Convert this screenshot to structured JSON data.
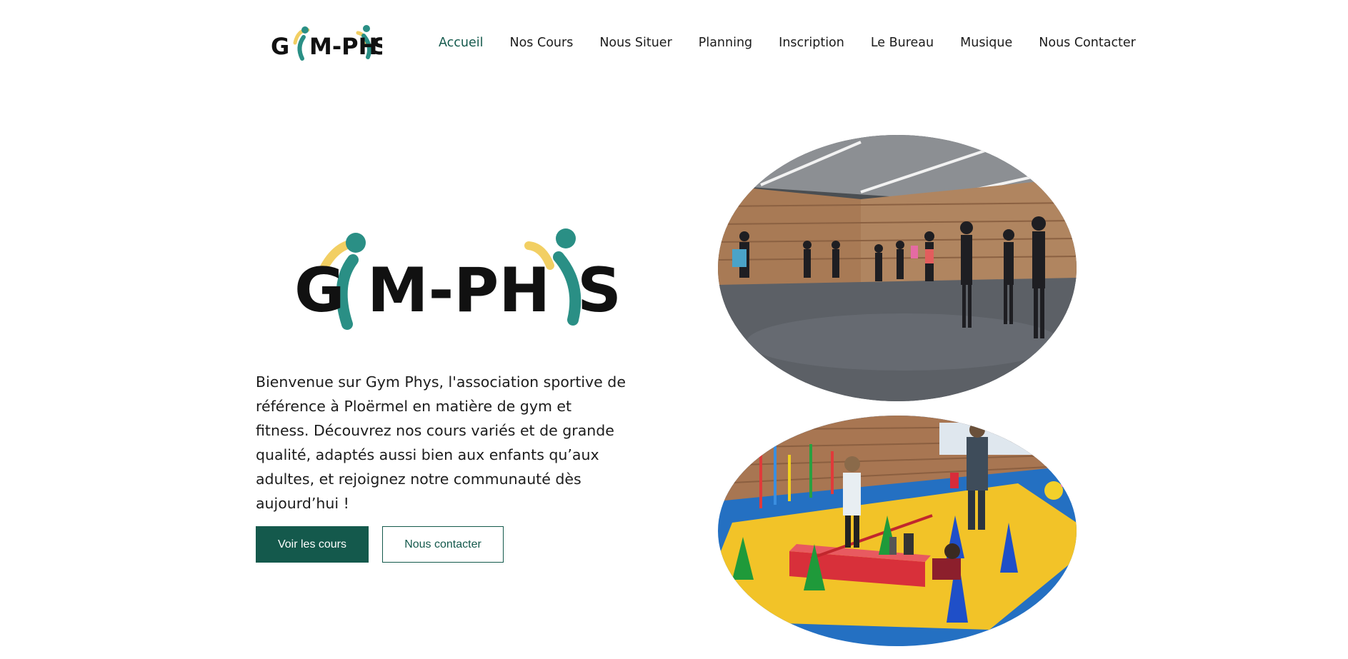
{
  "brand": {
    "logo_text": "GYM-PHYS",
    "colors": {
      "primary": "#14594c",
      "teal": "#2a8f85",
      "yellow": "#f2cf63",
      "text": "#1c1c1c"
    }
  },
  "nav": {
    "items": [
      {
        "label": "Accueil",
        "active": true
      },
      {
        "label": "Nos Cours"
      },
      {
        "label": "Nous Situer"
      },
      {
        "label": "Planning"
      },
      {
        "label": "Inscription"
      },
      {
        "label": "Le Bureau"
      },
      {
        "label": "Musique"
      },
      {
        "label": "Nous Contacter"
      }
    ]
  },
  "hero": {
    "intro": "Bienvenue sur Gym Phys, l'association sportive de référence à Ploërmel en matière de gym et fitness. Découvrez nos cours variés et de grande qualité, adaptés aussi bien aux enfants qu’aux adultes, et rejoignez notre communauté dès aujourd’hui !",
    "primary_button": "Voir les cours",
    "secondary_button": "Nous contacter"
  },
  "images": {
    "top": "fitness-class-photo",
    "bottom": "kids-gym-course-photo"
  }
}
